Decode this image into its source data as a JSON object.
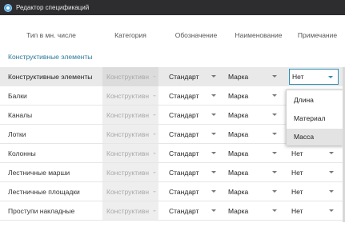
{
  "window": {
    "title": "Редактор спецификаций"
  },
  "header": {
    "col_type": "Тип в мн. числе",
    "col_category": "Категория",
    "col_designation": "Обозначение",
    "col_name": "Наименование",
    "col_note": "Примечание"
  },
  "group": {
    "title": "Конструктивные элементы"
  },
  "rows": [
    {
      "type": "Конструктивные элементы",
      "category": "Конструктивн",
      "designation": "Стандарт",
      "name": "Марка",
      "note": "Нет"
    },
    {
      "type": "Балки",
      "category": "Конструктивн",
      "designation": "Стандарт",
      "name": "Марка",
      "note": ""
    },
    {
      "type": "Каналы",
      "category": "Конструктивн",
      "designation": "Стандарт",
      "name": "Марка",
      "note": ""
    },
    {
      "type": "Лотки",
      "category": "Конструктивн",
      "designation": "Стандарт",
      "name": "Марка",
      "note": ""
    },
    {
      "type": "Колонны",
      "category": "Конструктивн",
      "designation": "Стандарт",
      "name": "Марка",
      "note": "Нет"
    },
    {
      "type": "Лестничные марши",
      "category": "Конструктивн",
      "designation": "Стандарт",
      "name": "Марка",
      "note": "Нет"
    },
    {
      "type": "Лестничные площадки",
      "category": "Конструктивн",
      "designation": "Стандарт",
      "name": "Марка",
      "note": "Нет"
    },
    {
      "type": "Проступи накладные",
      "category": "Конструктивн",
      "designation": "Стандарт",
      "name": "Марка",
      "note": "Нет"
    }
  ],
  "dropdown_options": [
    "Длина",
    "Материал",
    "Масса"
  ],
  "dropdown_selected": "Масса",
  "colors": {
    "accent": "#2b8fb5",
    "titlebar": "#2d2d30",
    "group_title": "#2b7a9c"
  }
}
